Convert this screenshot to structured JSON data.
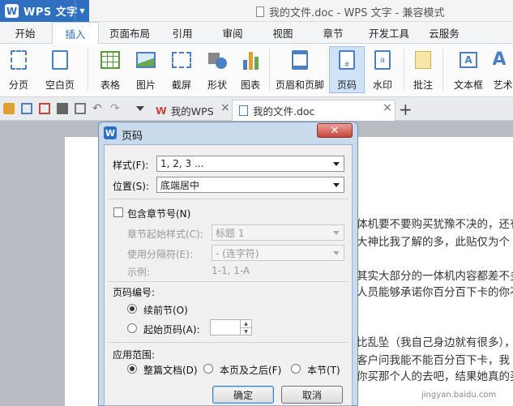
{
  "app": {
    "name": "WPS 文字",
    "logo": "W",
    "dropdown": "▼",
    "window_title": "我的文件.doc - WPS 文字 - 兼容模式"
  },
  "menu": {
    "tabs": [
      "开始",
      "插入",
      "页面布局",
      "引用",
      "审阅",
      "视图",
      "章节",
      "开发工具",
      "云服务"
    ],
    "active": "插入"
  },
  "ribbon": {
    "buttons": [
      {
        "label": "分页",
        "icon": "page-break-icon",
        "dropdown": true
      },
      {
        "label": "空白页",
        "icon": "blank-page-icon",
        "dropdown": true
      },
      {
        "label": "表格",
        "icon": "table-icon",
        "dropdown": true
      },
      {
        "label": "图片",
        "icon": "picture-icon",
        "dropdown": true
      },
      {
        "label": "截屏",
        "icon": "screenshot-icon",
        "dropdown": true
      },
      {
        "label": "形状",
        "icon": "shape-icon",
        "dropdown": true
      },
      {
        "label": "图表",
        "icon": "chart-icon",
        "dropdown": false
      },
      {
        "label": "页眉和页脚",
        "icon": "header-footer-icon",
        "dropdown": false
      },
      {
        "label": "页码",
        "icon": "page-number-icon",
        "dropdown": true,
        "selected": true
      },
      {
        "label": "水印",
        "icon": "watermark-icon",
        "dropdown": true
      },
      {
        "label": "批注",
        "icon": "comment-icon",
        "dropdown": false
      },
      {
        "label": "文本框",
        "icon": "textbox-icon",
        "dropdown": true
      },
      {
        "label": "艺术",
        "icon": "wordart-icon",
        "dropdown": false
      }
    ]
  },
  "tabs": [
    {
      "label": "我的WPS",
      "icon": "wps-logo-icon",
      "close": "×"
    },
    {
      "label": "我的文件.doc",
      "icon": "document-icon",
      "close": "×",
      "active": true
    }
  ],
  "document": {
    "lines": [
      "体机要不要购买犹豫不决的，还有",
      "大神比我了解的多，此贴仅为个",
      "其实大部分的一体机内容都差不多",
      "人员能够承诺你百分百下卡的你不",
      "比乱坠（我自己身边就有很多），",
      "客户问我能不能百分百下卡，我",
      "你买那个人的去吧，结果她真的买"
    ]
  },
  "dialog": {
    "title": "页码",
    "close": "✕",
    "style_label": "样式(F):",
    "style_value": "1, 2, 3 ...",
    "position_label": "位置(S):",
    "position_value": "底端居中",
    "include_chapter": "包含章节号(N)",
    "chapter_style_label": "章节起始样式(C):",
    "chapter_style_value": "标题 1",
    "separator_label": "使用分隔符(E):",
    "separator_value": "-    (连字符)",
    "example_label": "示例:",
    "example_value": "1-1, 1-A",
    "numbering_title": "页码编号:",
    "continue_label": "续前节(O)",
    "start_label": "起始页码(A):",
    "start_value": "",
    "scope_title": "应用范围:",
    "scope_whole": "整篇文档(D)",
    "scope_after": "本页及之后(F)",
    "scope_section": "本节(T)",
    "ok": "确定",
    "cancel": "取消"
  },
  "watermark": "jingyan.baidu.com",
  "colors": {
    "accent": "#2f6fc0",
    "close": "#c7463a"
  }
}
